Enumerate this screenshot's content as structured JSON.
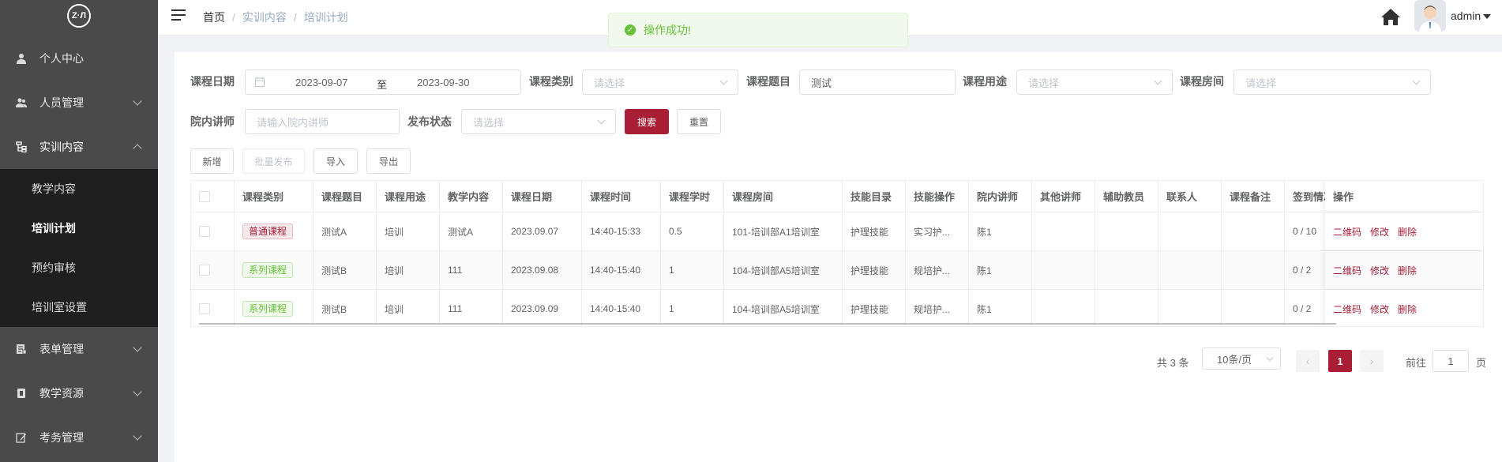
{
  "sidebar": {
    "logo_text": "Z·Л",
    "items": [
      {
        "label": "个人中心",
        "icon": "user-icon"
      },
      {
        "label": "人员管理",
        "icon": "users-icon"
      },
      {
        "label": "实训内容",
        "icon": "tree-icon"
      },
      {
        "label": "表单管理",
        "icon": "form-icon"
      },
      {
        "label": "教学资源",
        "icon": "book-icon"
      },
      {
        "label": "考务管理",
        "icon": "edit-icon"
      }
    ],
    "submenu": [
      "教学内容",
      "培训计划",
      "预约审核",
      "培训室设置"
    ]
  },
  "header": {
    "breadcrumb": [
      "首页",
      "实训内容",
      "培训计划"
    ],
    "user": "admin"
  },
  "toast": {
    "message": "操作成功!"
  },
  "filters": {
    "date_label": "课程日期",
    "date_start": "2023-09-07",
    "date_sep": "至",
    "date_end": "2023-09-30",
    "category_label": "课程类别",
    "category_placeholder": "请选择",
    "topic_label": "课程题目",
    "topic_value": "测试",
    "purpose_label": "课程用途",
    "purpose_placeholder": "请选择",
    "room_label": "课程房间",
    "room_placeholder": "请选择",
    "lecturer_label": "院内讲师",
    "lecturer_placeholder": "请输入院内讲师",
    "status_label": "发布状态",
    "status_placeholder": "请选择",
    "search_btn": "搜索",
    "reset_btn": "重置"
  },
  "toolbar": {
    "add": "新增",
    "batch_publish": "批量发布",
    "import": "导入",
    "export": "导出"
  },
  "table": {
    "columns": [
      "课程类别",
      "课程题目",
      "课程用途",
      "教学内容",
      "课程日期",
      "课程时间",
      "课程学时",
      "课程房间",
      "技能目录",
      "技能操作",
      "院内讲师",
      "其他讲师",
      "辅助教员",
      "联系人",
      "课程备注",
      "签到情况",
      "操作"
    ],
    "rows": [
      {
        "category": "普通课程",
        "tag": "red",
        "topic": "测试A",
        "purpose": "培训",
        "content": "测试A",
        "date": "2023.09.07",
        "time": "14:40-15:33",
        "hours": "0.5",
        "room": "101-培训部A1培训室",
        "skill_dir": "护理技能",
        "skill_op": "实习护...",
        "lecturer": "陈1",
        "other": "",
        "assistant": "",
        "contact": "",
        "note": "",
        "signin": "0 / 10"
      },
      {
        "category": "系列课程",
        "tag": "green",
        "topic": "测试B",
        "purpose": "培训",
        "content": "111",
        "date": "2023.09.08",
        "time": "14:40-15:40",
        "hours": "1",
        "room": "104-培训部A5培训室",
        "skill_dir": "护理技能",
        "skill_op": "规培护...",
        "lecturer": "陈1",
        "other": "",
        "assistant": "",
        "contact": "",
        "note": "",
        "signin": "0 / 2"
      },
      {
        "category": "系列课程",
        "tag": "green",
        "topic": "测试B",
        "purpose": "培训",
        "content": "111",
        "date": "2023.09.09",
        "time": "14:40-15:40",
        "hours": "1",
        "room": "104-培训部A5培训室",
        "skill_dir": "护理技能",
        "skill_op": "规培护...",
        "lecturer": "陈1",
        "other": "",
        "assistant": "",
        "contact": "",
        "note": "",
        "signin": "0 / 2"
      }
    ],
    "ops": {
      "qrcode": "二维码",
      "edit": "修改",
      "delete": "删除"
    }
  },
  "pagination": {
    "total": "共 3 条",
    "page_size": "10条/页",
    "current": "1",
    "prev": "‹",
    "next": "›",
    "goto_label": "前往",
    "goto_value": "1",
    "page_unit": "页"
  },
  "colors": {
    "brand": "#a91d35",
    "sidebar": "#4a4a4a",
    "success": "#67c23a"
  }
}
